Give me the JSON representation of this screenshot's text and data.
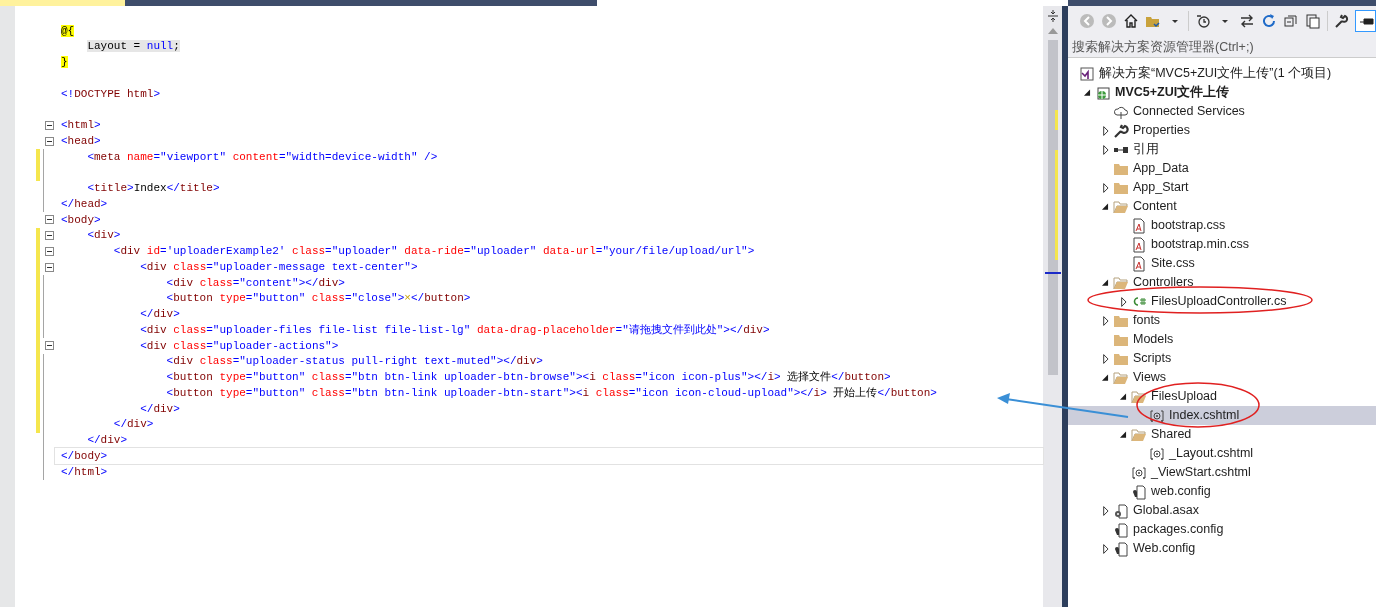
{
  "editor": {
    "lines": [
      {
        "tokens": [
          {
            "text": "@{",
            "kind": "razor"
          }
        ]
      },
      {
        "indented": true,
        "tokens": [
          {
            "text": "Layout = ",
            "kind": "cs"
          },
          {
            "text": "null",
            "kind": "cskey"
          },
          {
            "text": ";",
            "kind": "cs"
          }
        ]
      },
      {
        "tokens": [
          {
            "text": "}",
            "kind": "razor"
          }
        ]
      },
      {
        "blank_line_before": true,
        "tokens": [
          {
            "text": "<!",
            "kind": "punct"
          },
          {
            "text": "DOCTYPE html",
            "kind": "tag"
          },
          {
            "text": ">",
            "kind": "punct"
          }
        ]
      },
      {
        "blank_line_before": true,
        "fold_expanded": true,
        "tokens": [
          {
            "text": "<",
            "kind": "punct"
          },
          {
            "text": "html",
            "kind": "tag"
          },
          {
            "text": ">",
            "kind": "punct"
          }
        ]
      },
      {
        "fold_expanded": true,
        "tokens": [
          {
            "text": "<",
            "kind": "punct"
          },
          {
            "text": "head",
            "kind": "tag"
          },
          {
            "text": ">",
            "kind": "punct"
          }
        ]
      },
      {
        "modified": true,
        "tokens": [
          {
            "text": "    <",
            "kind": "punct"
          },
          {
            "text": "meta",
            "kind": "tag"
          },
          {
            "text": " name",
            "kind": "attr"
          },
          {
            "text": "=",
            "kind": "punct"
          },
          {
            "text": "\"viewport\"",
            "kind": "value"
          },
          {
            "text": " content",
            "kind": "attr"
          },
          {
            "text": "=",
            "kind": "punct"
          },
          {
            "text": "\"width=device-width\"",
            "kind": "value"
          },
          {
            "text": " />",
            "kind": "punct"
          }
        ]
      },
      {
        "modified": true
      },
      {
        "tokens": [
          {
            "text": "    <",
            "kind": "punct"
          },
          {
            "text": "title",
            "kind": "tag"
          },
          {
            "text": ">",
            "kind": "punct"
          },
          {
            "text": "Index",
            "kind": "text"
          },
          {
            "text": "</",
            "kind": "punct"
          },
          {
            "text": "title",
            "kind": "tag"
          },
          {
            "text": ">",
            "kind": "punct"
          }
        ]
      },
      {
        "tokens": [
          {
            "text": "</",
            "kind": "punct"
          },
          {
            "text": "head",
            "kind": "tag"
          },
          {
            "text": ">",
            "kind": "punct"
          }
        ]
      },
      {
        "fold_expanded": true,
        "tokens": [
          {
            "text": "<",
            "kind": "punct"
          },
          {
            "text": "body",
            "kind": "tag"
          },
          {
            "text": ">",
            "kind": "punct"
          }
        ]
      },
      {
        "fold_expanded": true,
        "modified": true,
        "tokens": [
          {
            "text": "    <",
            "kind": "punct"
          },
          {
            "text": "div",
            "kind": "tag"
          },
          {
            "text": ">",
            "kind": "punct"
          }
        ]
      },
      {
        "fold_expanded": true,
        "modified": true,
        "tokens": [
          {
            "text": "        <",
            "kind": "punct"
          },
          {
            "text": "div",
            "kind": "tag"
          },
          {
            "text": " id",
            "kind": "attr"
          },
          {
            "text": "=",
            "kind": "punct"
          },
          {
            "text": "'uploaderExample2'",
            "kind": "value"
          },
          {
            "text": " class",
            "kind": "attr"
          },
          {
            "text": "=",
            "kind": "punct"
          },
          {
            "text": "\"uploader\"",
            "kind": "value"
          },
          {
            "text": " data-ride",
            "kind": "attr"
          },
          {
            "text": "=",
            "kind": "punct"
          },
          {
            "text": "\"uploader\"",
            "kind": "value"
          },
          {
            "text": " data-url",
            "kind": "attr"
          },
          {
            "text": "=",
            "kind": "punct"
          },
          {
            "text": "\"your/file/upload/url\"",
            "kind": "value"
          },
          {
            "text": ">",
            "kind": "punct"
          }
        ]
      },
      {
        "fold_expanded": true,
        "modified": true,
        "tokens": [
          {
            "text": "            <",
            "kind": "punct"
          },
          {
            "text": "div",
            "kind": "tag"
          },
          {
            "text": " class",
            "kind": "attr"
          },
          {
            "text": "=",
            "kind": "punct"
          },
          {
            "text": "\"uploader-message text-center\"",
            "kind": "value"
          },
          {
            "text": ">",
            "kind": "punct"
          }
        ]
      },
      {
        "modified": true,
        "tokens": [
          {
            "text": "                <",
            "kind": "punct"
          },
          {
            "text": "div",
            "kind": "tag"
          },
          {
            "text": " class",
            "kind": "attr"
          },
          {
            "text": "=",
            "kind": "punct"
          },
          {
            "text": "\"content\"",
            "kind": "value"
          },
          {
            "text": "></",
            "kind": "punct"
          },
          {
            "text": "div",
            "kind": "tag"
          },
          {
            "text": ">",
            "kind": "punct"
          }
        ]
      },
      {
        "modified": true,
        "tokens": [
          {
            "text": "                <",
            "kind": "punct"
          },
          {
            "text": "button",
            "kind": "tag"
          },
          {
            "text": " type",
            "kind": "attr"
          },
          {
            "text": "=",
            "kind": "punct"
          },
          {
            "text": "\"button\"",
            "kind": "value"
          },
          {
            "text": " class",
            "kind": "attr"
          },
          {
            "text": "=",
            "kind": "punct"
          },
          {
            "text": "\"close\"",
            "kind": "value"
          },
          {
            "text": ">",
            "kind": "punct"
          },
          {
            "text": "×",
            "kind": "entity"
          },
          {
            "text": "</",
            "kind": "punct"
          },
          {
            "text": "button",
            "kind": "tag"
          },
          {
            "text": ">",
            "kind": "punct"
          }
        ]
      },
      {
        "modified": true,
        "tokens": [
          {
            "text": "            </",
            "kind": "punct"
          },
          {
            "text": "div",
            "kind": "tag"
          },
          {
            "text": ">",
            "kind": "punct"
          }
        ]
      },
      {
        "modified": true,
        "tokens": [
          {
            "text": "            <",
            "kind": "punct"
          },
          {
            "text": "div",
            "kind": "tag"
          },
          {
            "text": " class",
            "kind": "attr"
          },
          {
            "text": "=",
            "kind": "punct"
          },
          {
            "text": "\"uploader-files file-list file-list-lg\"",
            "kind": "value"
          },
          {
            "text": " data-drag-placeholder",
            "kind": "attr"
          },
          {
            "text": "=",
            "kind": "punct"
          },
          {
            "text": "\"请拖拽文件到此处\"",
            "kind": "value"
          },
          {
            "text": "></",
            "kind": "punct"
          },
          {
            "text": "div",
            "kind": "tag"
          },
          {
            "text": ">",
            "kind": "punct"
          }
        ]
      },
      {
        "fold_expanded": true,
        "modified": true,
        "tokens": [
          {
            "text": "            <",
            "kind": "punct"
          },
          {
            "text": "div",
            "kind": "tag"
          },
          {
            "text": " class",
            "kind": "attr"
          },
          {
            "text": "=",
            "kind": "punct"
          },
          {
            "text": "\"uploader-actions\"",
            "kind": "value"
          },
          {
            "text": ">",
            "kind": "punct"
          }
        ]
      },
      {
        "modified": true,
        "tokens": [
          {
            "text": "                <",
            "kind": "punct"
          },
          {
            "text": "div",
            "kind": "tag"
          },
          {
            "text": " class",
            "kind": "attr"
          },
          {
            "text": "=",
            "kind": "punct"
          },
          {
            "text": "\"uploader-status pull-right text-muted\"",
            "kind": "value"
          },
          {
            "text": "></",
            "kind": "punct"
          },
          {
            "text": "div",
            "kind": "tag"
          },
          {
            "text": ">",
            "kind": "punct"
          }
        ]
      },
      {
        "modified": true,
        "tokens": [
          {
            "text": "                <",
            "kind": "punct"
          },
          {
            "text": "button",
            "kind": "tag"
          },
          {
            "text": " type",
            "kind": "attr"
          },
          {
            "text": "=",
            "kind": "punct"
          },
          {
            "text": "\"button\"",
            "kind": "value"
          },
          {
            "text": " class",
            "kind": "attr"
          },
          {
            "text": "=",
            "kind": "punct"
          },
          {
            "text": "\"btn btn-link uploader-btn-browse\"",
            "kind": "value"
          },
          {
            "text": "><",
            "kind": "punct"
          },
          {
            "text": "i",
            "kind": "tag"
          },
          {
            "text": " class",
            "kind": "attr"
          },
          {
            "text": "=",
            "kind": "punct"
          },
          {
            "text": "\"icon icon-plus\"",
            "kind": "value"
          },
          {
            "text": "></",
            "kind": "punct"
          },
          {
            "text": "i",
            "kind": "tag"
          },
          {
            "text": ">",
            "kind": "punct"
          },
          {
            "text": " 选择文件",
            "kind": "text"
          },
          {
            "text": "</",
            "kind": "punct"
          },
          {
            "text": "button",
            "kind": "tag"
          },
          {
            "text": ">",
            "kind": "punct"
          }
        ]
      },
      {
        "modified": true,
        "tokens": [
          {
            "text": "                <",
            "kind": "punct"
          },
          {
            "text": "button",
            "kind": "tag"
          },
          {
            "text": " type",
            "kind": "attr"
          },
          {
            "text": "=",
            "kind": "punct"
          },
          {
            "text": "\"button\"",
            "kind": "value"
          },
          {
            "text": " class",
            "kind": "attr"
          },
          {
            "text": "=",
            "kind": "punct"
          },
          {
            "text": "\"btn btn-link uploader-btn-start\"",
            "kind": "value"
          },
          {
            "text": "><",
            "kind": "punct"
          },
          {
            "text": "i",
            "kind": "tag"
          },
          {
            "text": " class",
            "kind": "attr"
          },
          {
            "text": "=",
            "kind": "punct"
          },
          {
            "text": "\"icon icon-cloud-upload\"",
            "kind": "value"
          },
          {
            "text": "></",
            "kind": "punct"
          },
          {
            "text": "i",
            "kind": "tag"
          },
          {
            "text": ">",
            "kind": "punct"
          },
          {
            "text": " 开始上传",
            "kind": "text"
          },
          {
            "text": "</",
            "kind": "punct"
          },
          {
            "text": "button",
            "kind": "tag"
          },
          {
            "text": ">",
            "kind": "punct"
          }
        ]
      },
      {
        "modified": true,
        "tokens": [
          {
            "text": "            </",
            "kind": "punct"
          },
          {
            "text": "div",
            "kind": "tag"
          },
          {
            "text": ">",
            "kind": "punct"
          }
        ]
      },
      {
        "modified": true,
        "tokens": [
          {
            "text": "        </",
            "kind": "punct"
          },
          {
            "text": "div",
            "kind": "tag"
          },
          {
            "text": ">",
            "kind": "punct"
          }
        ]
      },
      {
        "tokens": [
          {
            "text": "    </",
            "kind": "punct"
          },
          {
            "text": "div",
            "kind": "tag"
          },
          {
            "text": ">",
            "kind": "punct"
          }
        ]
      },
      {
        "current": true,
        "tokens": [
          {
            "text": "</",
            "kind": "punct"
          },
          {
            "text": "body",
            "kind": "tag"
          },
          {
            "text": ">",
            "kind": "punct"
          }
        ]
      },
      {
        "tokens": [
          {
            "text": "</",
            "kind": "punct"
          },
          {
            "text": "html",
            "kind": "tag"
          },
          {
            "text": ">",
            "kind": "punct"
          }
        ]
      }
    ]
  },
  "solution_explorer": {
    "search": {
      "placeholder": "搜索解决方案资源管理器(Ctrl+;)"
    },
    "tree": [
      {
        "label": "解决方案“MVC5+ZUI文件上传”(1 个项目)",
        "kind": "solution",
        "selected": false
      },
      {
        "label": "MVC5+ZUI文件上传",
        "kind": "project",
        "expanded": true,
        "selected": false,
        "children": [
          {
            "label": "Connected Services",
            "kind": "cloud",
            "selected": false
          },
          {
            "label": "Properties",
            "kind": "wrench",
            "expanded": false,
            "selected": false
          },
          {
            "label": "引用",
            "kind": "reference",
            "expanded": false,
            "selected": false
          },
          {
            "label": "App_Data",
            "kind": "folder",
            "selected": false
          },
          {
            "label": "App_Start",
            "kind": "folder",
            "expanded": false,
            "selected": false
          },
          {
            "label": "Content",
            "kind": "folder",
            "expanded": true,
            "selected": false,
            "children": [
              {
                "label": "bootstrap.css",
                "kind": "css",
                "selected": false
              },
              {
                "label": "bootstrap.min.css",
                "kind": "css",
                "selected": false
              },
              {
                "label": "Site.css",
                "kind": "css",
                "selected": false
              }
            ]
          },
          {
            "label": "Controllers",
            "kind": "folder",
            "expanded": true,
            "selected": false,
            "children": [
              {
                "label": "FilesUploadController.cs",
                "kind": "csharp",
                "expanded": false,
                "selected": false
              }
            ]
          },
          {
            "label": "fonts",
            "kind": "folder",
            "expanded": false,
            "selected": false
          },
          {
            "label": "Models",
            "kind": "folder",
            "selected": false
          },
          {
            "label": "Scripts",
            "kind": "folder",
            "expanded": false,
            "selected": false
          },
          {
            "label": "Views",
            "kind": "folder",
            "expanded": true,
            "selected": false,
            "children": [
              {
                "label": "FilesUpload",
                "kind": "folder",
                "expanded": true,
                "selected": false,
                "children": [
                  {
                    "label": "Index.cshtml",
                    "kind": "razor",
                    "selected": true
                  }
                ]
              },
              {
                "label": "Shared",
                "kind": "folder",
                "expanded": true,
                "selected": false,
                "children": [
                  {
                    "label": "_Layout.cshtml",
                    "kind": "razor",
                    "selected": false
                  }
                ]
              },
              {
                "label": "_ViewStart.cshtml",
                "kind": "razor",
                "selected": false
              },
              {
                "label": "web.config",
                "kind": "config",
                "selected": false
              }
            ]
          },
          {
            "label": "Global.asax",
            "kind": "global",
            "expanded": false,
            "selected": false
          },
          {
            "label": "packages.config",
            "kind": "config",
            "selected": false
          },
          {
            "label": "Web.config",
            "kind": "config",
            "expanded": false,
            "selected": false
          }
        ]
      }
    ]
  }
}
